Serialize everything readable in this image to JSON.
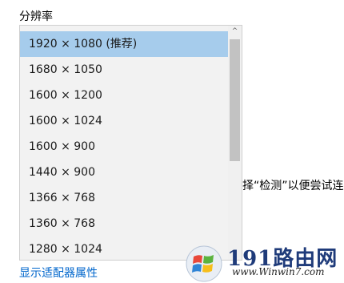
{
  "settings": {
    "section_label": "分辨率",
    "partial_hint": "择“检测”以便尝试连接",
    "adapter_link": "显示适配器属性"
  },
  "dropdown": {
    "selected_index": 0,
    "options": [
      "1920 × 1080 (推荐)",
      "1680 × 1050",
      "1600 × 1200",
      "1600 × 1024",
      "1600 × 900",
      "1440 × 900",
      "1366 × 768",
      "1360 × 768",
      "1280 × 1024"
    ],
    "scroll_up_glyph": "^",
    "scroll_position": 0
  },
  "watermark": {
    "brand": "191路由网",
    "url": "www.Winwin7.com"
  },
  "colors": {
    "selected_bg": "#a6ccec",
    "link": "#0066cc",
    "list_bg": "#f2f2f2",
    "scroll_thumb": "#c2c2c2"
  }
}
